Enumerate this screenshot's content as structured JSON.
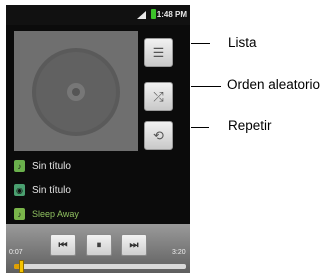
{
  "status_bar": {
    "time": "1:48 PM",
    "signal_icon": "signal-icon",
    "battery_icon": "battery-icon",
    "battery_color": "#3cc12a"
  },
  "album_art": {
    "icon": "disc-icon"
  },
  "side_buttons": [
    {
      "name": "list-button",
      "icon": "list-icon",
      "glyph": "☰"
    },
    {
      "name": "shuffle-button",
      "icon": "shuffle-icon",
      "glyph": "⤮"
    },
    {
      "name": "repeat-button",
      "icon": "repeat-icon",
      "glyph": "⟲"
    }
  ],
  "tracks": [
    {
      "label": "Sin título",
      "icon": "track-icon",
      "color": "#6ab04c"
    },
    {
      "label": "Sin título",
      "icon": "track-icon",
      "color": "#4aa070"
    },
    {
      "label": "Sleep Away",
      "icon": "track-icon",
      "color": "#7ab54a"
    }
  ],
  "playback": {
    "elapsed": "0:07",
    "total": "3:20",
    "progress_fraction": 0.035,
    "prev_glyph": "⏮",
    "pause_glyph": "⏸",
    "next_glyph": "⏭"
  },
  "callouts": {
    "list": "Lista",
    "shuffle": "Orden aleatorio",
    "repeat": "Repetir"
  }
}
